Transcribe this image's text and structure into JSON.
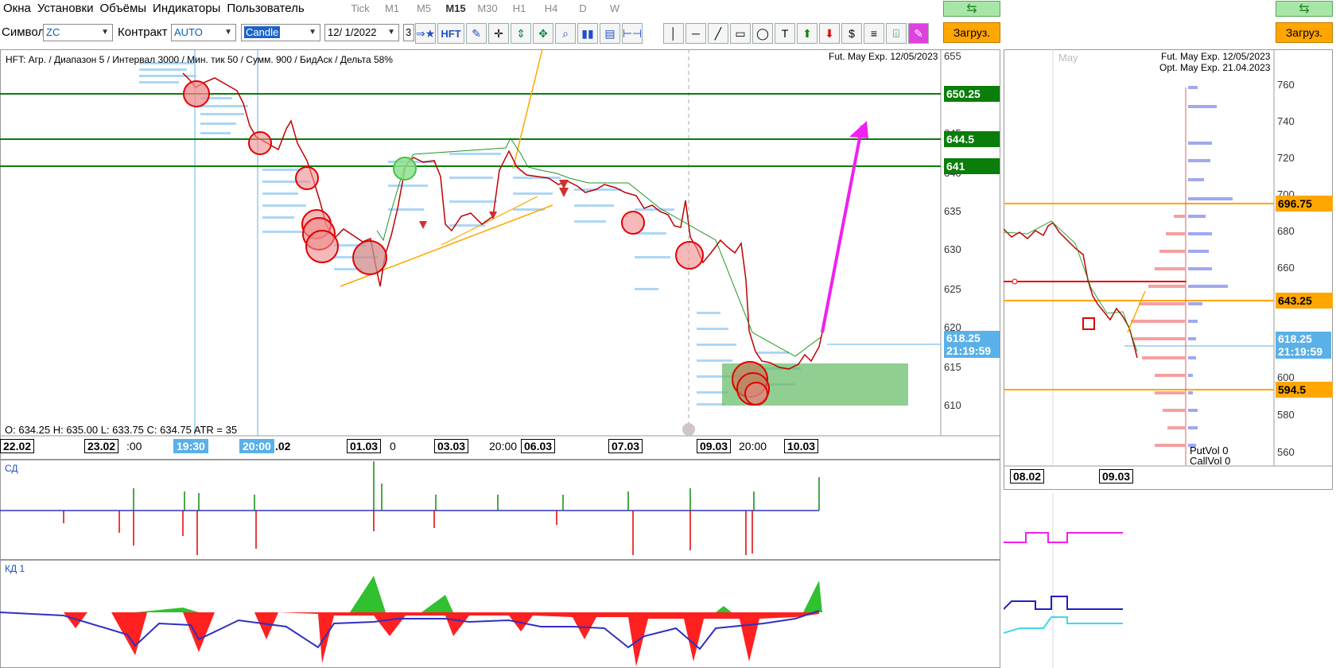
{
  "menu": [
    "Окна",
    "Установки",
    "Объёмы",
    "Индикаторы",
    "Пользователь"
  ],
  "timeframes": [
    {
      "label": "Tick",
      "active": false
    },
    {
      "label": "M1",
      "active": false
    },
    {
      "label": "M5",
      "active": false
    },
    {
      "label": "M15",
      "active": true
    },
    {
      "label": "M30",
      "active": false
    },
    {
      "label": "H1",
      "active": false
    },
    {
      "label": "H4",
      "active": false
    },
    {
      "label": "D",
      "active": false
    },
    {
      "label": "W",
      "active": false
    }
  ],
  "toolbar": {
    "symbol_label": "Символ",
    "symbol_value": "ZC",
    "contract_label": "Контракт",
    "contract_value": "AUTO",
    "chart_type": "Candle",
    "date_value": "12/ 1/2022",
    "count_value": "3",
    "hft_label": "HFT",
    "load_label": "Загруз.",
    "load_label_right": "Загруз."
  },
  "main_chart": {
    "info_line": "HFT: Агр. / Диапазон 5 / Интервал 3000 / Мин. тик 50 / Сумм. 900 / БидАск / Дельта 58%",
    "contract_line": "Fut. May Exp. 12/05/2023",
    "ohlc_line": "O: 634.25  H: 635.00  L: 633.75  C: 634.75  ATR = 35",
    "price_axis": [
      "655",
      "645",
      "640",
      "635",
      "630",
      "625",
      "620",
      "615",
      "610"
    ],
    "level_tags": [
      "650.25",
      "644.5",
      "641"
    ],
    "current_price": "618.25",
    "current_time": "21:19:59",
    "date_labels_boxed": [
      "22.02",
      "23.02",
      "01.03",
      "03.03",
      "06.03",
      "07.03",
      "09.03",
      "10.03"
    ],
    "date_labels_plain": [
      ":00",
      "0",
      "20:00",
      "20:00"
    ],
    "date_labels_highlighted": [
      "19:30",
      "20:00"
    ],
    "date_partial": ".02"
  },
  "indicators": {
    "cd_title": "СД",
    "kd_title": "КД 1"
  },
  "right_chart": {
    "month_label": "May",
    "contract_line1": "Fut. May Exp. 12/05/2023",
    "contract_line2": "Opt. May Exp. 21.04.2023",
    "price_axis": [
      "760",
      "740",
      "720",
      "700",
      "680",
      "660",
      "640",
      "620",
      "600",
      "580",
      "560"
    ],
    "level_tags": [
      "696.75",
      "643.25",
      "594.5"
    ],
    "current_price": "618.25",
    "current_time": "21:19:59",
    "put_vol": "PutVol  0",
    "call_vol": "CallVol  0",
    "date_labels": [
      "08.02",
      "09.03"
    ]
  },
  "colors": {
    "level_green": "#0a7d0a",
    "level_orange": "#ffa600",
    "arrow_magenta": "#f020f0",
    "zone_green": "#6cbd6c",
    "bid_red": "#e00000",
    "ask_blue": "#1010c0"
  }
}
